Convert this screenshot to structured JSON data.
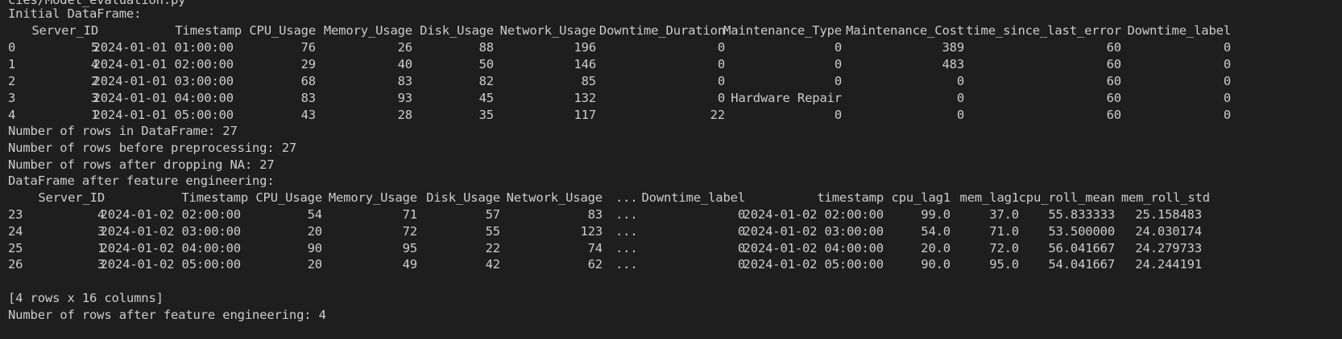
{
  "terminal": {
    "header_fragment": "cies/Model_evaluation.py",
    "initial_title": "Initial DataFrame:",
    "initial_columns": [
      "Server_ID",
      "Timestamp",
      "CPU_Usage",
      "Memory_Usage",
      "Disk_Usage",
      "Network_Usage",
      "Downtime_Duration",
      "Maintenance_Type",
      "Maintenance_Cost",
      "time_since_last_error",
      "Downtime_label"
    ],
    "initial_rows": [
      [
        "0",
        "5",
        "2024-01-01 01:00:00",
        "76",
        "26",
        "88",
        "196",
        "0",
        "0",
        "389",
        "60",
        "0"
      ],
      [
        "1",
        "4",
        "2024-01-01 02:00:00",
        "29",
        "40",
        "50",
        "146",
        "0",
        "0",
        "483",
        "60",
        "0"
      ],
      [
        "2",
        "2",
        "2024-01-01 03:00:00",
        "68",
        "83",
        "82",
        "85",
        "0",
        "0",
        "0",
        "60",
        "0"
      ],
      [
        "3",
        "3",
        "2024-01-01 04:00:00",
        "83",
        "93",
        "45",
        "132",
        "0",
        "Hardware Repair",
        "0",
        "60",
        "0"
      ],
      [
        "4",
        "1",
        "2024-01-01 05:00:00",
        "43",
        "28",
        "35",
        "117",
        "22",
        "0",
        "0",
        "60",
        "0"
      ]
    ],
    "msg_rows": "Number of rows in DataFrame: 27",
    "msg_before": "Number of rows before preprocessing: 27",
    "msg_after_na": "Number of rows after dropping NA: 27",
    "fe_title": "DataFrame after feature engineering:",
    "fe_columns": [
      "Server_ID",
      "Timestamp",
      "CPU_Usage",
      "Memory_Usage",
      "Disk_Usage",
      "Network_Usage",
      "...",
      "Downtime_label",
      "timestamp",
      "cpu_lag1",
      "mem_lag1",
      "cpu_roll_mean",
      "mem_roll_std"
    ],
    "fe_rows": [
      [
        "23",
        "4",
        "2024-01-02 02:00:00",
        "54",
        "71",
        "57",
        "83",
        "...",
        "0",
        "2024-01-02 02:00:00",
        "99.0",
        "37.0",
        "55.833333",
        "25.158483"
      ],
      [
        "24",
        "3",
        "2024-01-02 03:00:00",
        "20",
        "72",
        "55",
        "123",
        "...",
        "0",
        "2024-01-02 03:00:00",
        "54.0",
        "71.0",
        "53.500000",
        "24.030174"
      ],
      [
        "25",
        "1",
        "2024-01-02 04:00:00",
        "90",
        "95",
        "22",
        "74",
        "...",
        "0",
        "2024-01-02 04:00:00",
        "20.0",
        "72.0",
        "56.041667",
        "24.279733"
      ],
      [
        "26",
        "3",
        "2024-01-02 05:00:00",
        "20",
        "49",
        "42",
        "62",
        "...",
        "0",
        "2024-01-02 05:00:00",
        "90.0",
        "95.0",
        "54.041667",
        "24.244191"
      ]
    ],
    "shape_note": "[4 rows x 16 columns]",
    "msg_after_fe": "Number of rows after feature engineering: 4"
  }
}
